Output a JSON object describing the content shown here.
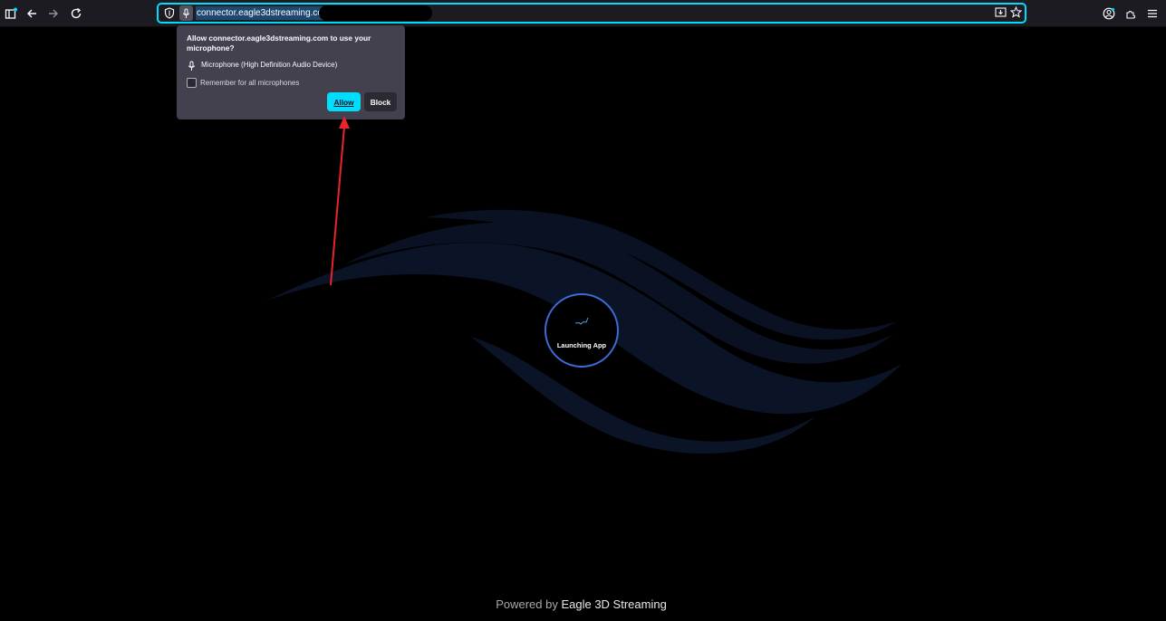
{
  "browser": {
    "url_text": "connector.eagle3dstreaming.com/",
    "icons": [
      "sidebar-icon",
      "back-icon",
      "forward-icon",
      "reload-icon",
      "shield-icon",
      "microphone-icon",
      "reader-icon",
      "bookmark-star-icon",
      "account-icon",
      "extensions-icon",
      "menu-icon"
    ],
    "accent_color": "#00ddff"
  },
  "permission_popup": {
    "title": "Allow connector.eagle3dstreaming.com to use your microphone?",
    "device": "Microphone (High Definition Audio Device)",
    "remember_label": "Remember for all microphones",
    "remember_checked": false,
    "allow_label": "Allow",
    "block_label": "Block"
  },
  "annotation": {
    "arrow_color": "#e8262a",
    "target": "allow-button"
  },
  "app": {
    "loading_text": "Launching App",
    "footer_prefix": "Powered by",
    "footer_brand": "Eagle 3D Streaming",
    "ring_color": "#3d6ad6",
    "logo_color": "#0b1326"
  }
}
